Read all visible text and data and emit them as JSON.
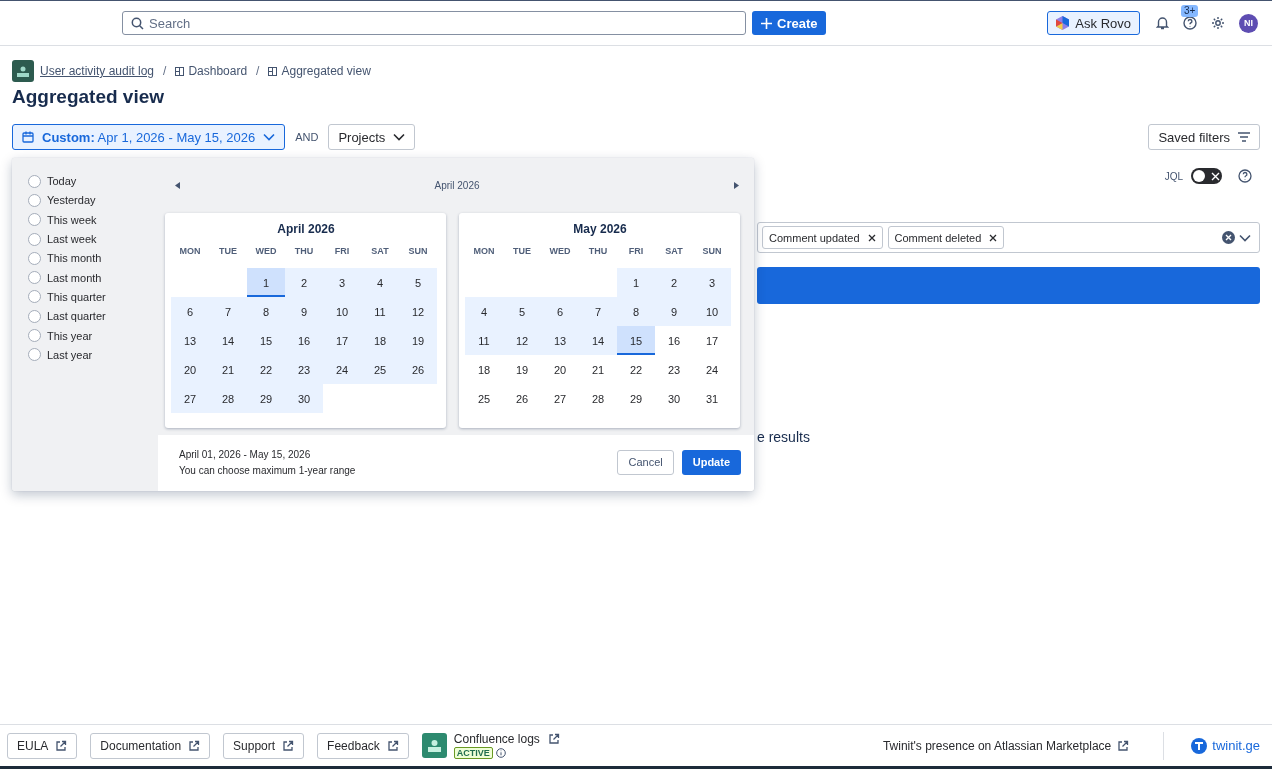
{
  "topbar": {
    "search": {
      "placeholder": "Search"
    },
    "create_button": "Create",
    "ask_button": "Ask Rovo",
    "notifications_badge": "3+",
    "avatar": "NI"
  },
  "breadcrumb_separator": "/",
  "breadcrumbs": [
    {
      "label": "User activity audit log",
      "kind": "link"
    },
    {
      "label": "Dashboard",
      "kind": "page"
    },
    {
      "label": "Aggregated view",
      "kind": "page"
    }
  ],
  "title": "Aggregated view",
  "filters": {
    "date_button": "**Custom:** Apr 1, 2026 - May 15, 2026",
    "operator": "AND",
    "projects": "Projects",
    "saved_filters": "Saved filters"
  },
  "jql": {
    "label": "JQL",
    "on": false
  },
  "event_chips": [
    "Comment updated",
    "Comment deleted"
  ],
  "results_text": "e results",
  "date_picker": {
    "presets": [
      {
        "label": "Today",
        "selected": false
      },
      {
        "label": "Yesterday",
        "selected": false
      },
      {
        "label": "This week",
        "selected": false
      },
      {
        "label": "Last week",
        "selected": false
      },
      {
        "label": "This month",
        "selected": false
      },
      {
        "label": "Last month",
        "selected": false
      },
      {
        "label": "This quarter",
        "selected": false
      },
      {
        "label": "Last quarter",
        "selected": false
      },
      {
        "label": "This year",
        "selected": false
      },
      {
        "label": "Last year",
        "selected": false
      }
    ],
    "nav_title": "April 2026",
    "months": [
      {
        "title": "April 2026",
        "weekdays": [
          "MON",
          "TUE",
          "WED",
          "THU",
          "FRI",
          "SAT",
          "SUN"
        ],
        "weeks": [
          [
            {
              "kind": "blank"
            },
            {
              "kind": "blank"
            },
            {
              "day": "1",
              "in_range": true,
              "selected": true
            },
            {
              "day": "2",
              "in_range": true,
              "selected": false
            },
            {
              "day": "3",
              "in_range": true,
              "selected": false
            },
            {
              "day": "4",
              "in_range": true,
              "selected": false
            },
            {
              "day": "5",
              "in_range": true,
              "selected": false
            }
          ],
          [
            {
              "day": "6",
              "in_range": true,
              "selected": false
            },
            {
              "day": "7",
              "in_range": true,
              "selected": false
            },
            {
              "day": "8",
              "in_range": true,
              "selected": false
            },
            {
              "day": "9",
              "in_range": true,
              "selected": false
            },
            {
              "day": "10",
              "in_range": true,
              "selected": false
            },
            {
              "day": "11",
              "in_range": true,
              "selected": false
            },
            {
              "day": "12",
              "in_range": true,
              "selected": false
            }
          ],
          [
            {
              "day": "13",
              "in_range": true,
              "selected": false
            },
            {
              "day": "14",
              "in_range": true,
              "selected": false
            },
            {
              "day": "15",
              "in_range": true,
              "selected": false
            },
            {
              "day": "16",
              "in_range": true,
              "selected": false
            },
            {
              "day": "17",
              "in_range": true,
              "selected": false
            },
            {
              "day": "18",
              "in_range": true,
              "selected": false
            },
            {
              "day": "19",
              "in_range": true,
              "selected": false
            }
          ],
          [
            {
              "day": "20",
              "in_range": true,
              "selected": false
            },
            {
              "day": "21",
              "in_range": true,
              "selected": false
            },
            {
              "day": "22",
              "in_range": true,
              "selected": false
            },
            {
              "day": "23",
              "in_range": true,
              "selected": false
            },
            {
              "day": "24",
              "in_range": true,
              "selected": false
            },
            {
              "day": "25",
              "in_range": true,
              "selected": false
            },
            {
              "day": "26",
              "in_range": true,
              "selected": false
            }
          ],
          [
            {
              "day": "27",
              "in_range": true,
              "selected": false
            },
            {
              "day": "28",
              "in_range": true,
              "selected": false
            },
            {
              "day": "29",
              "in_range": true,
              "selected": false
            },
            {
              "day": "30",
              "in_range": true,
              "selected": false
            },
            {
              "kind": "blank"
            },
            {
              "kind": "blank"
            },
            {
              "kind": "blank"
            }
          ]
        ]
      },
      {
        "title": "May 2026",
        "weekdays": [
          "MON",
          "TUE",
          "WED",
          "THU",
          "FRI",
          "SAT",
          "SUN"
        ],
        "weeks": [
          [
            {
              "kind": "blank"
            },
            {
              "kind": "blank"
            },
            {
              "kind": "blank"
            },
            {
              "kind": "blank"
            },
            {
              "day": "1",
              "in_range": true,
              "selected": false
            },
            {
              "day": "2",
              "in_range": true,
              "selected": false
            },
            {
              "day": "3",
              "in_range": true,
              "selected": false
            }
          ],
          [
            {
              "day": "4",
              "in_range": true,
              "selected": false
            },
            {
              "day": "5",
              "in_range": true,
              "selected": false
            },
            {
              "day": "6",
              "in_range": true,
              "selected": false
            },
            {
              "day": "7",
              "in_range": true,
              "selected": false
            },
            {
              "day": "8",
              "in_range": true,
              "selected": false
            },
            {
              "day": "9",
              "in_range": true,
              "selected": false
            },
            {
              "day": "10",
              "in_range": true,
              "selected": false
            }
          ],
          [
            {
              "day": "11",
              "in_range": true,
              "selected": false
            },
            {
              "day": "12",
              "in_range": true,
              "selected": false
            },
            {
              "day": "13",
              "in_range": true,
              "selected": false
            },
            {
              "day": "14",
              "in_range": true,
              "selected": false
            },
            {
              "day": "15",
              "in_range": true,
              "selected": true
            },
            {
              "day": "16",
              "in_range": false,
              "selected": false
            },
            {
              "day": "17",
              "in_range": false,
              "selected": false
            }
          ],
          [
            {
              "day": "18",
              "in_range": false,
              "selected": false
            },
            {
              "day": "19",
              "in_range": false,
              "selected": false
            },
            {
              "day": "20",
              "in_range": false,
              "selected": false
            },
            {
              "day": "21",
              "in_range": false,
              "selected": false
            },
            {
              "day": "22",
              "in_range": false,
              "selected": false
            },
            {
              "day": "23",
              "in_range": false,
              "selected": false
            },
            {
              "day": "24",
              "in_range": false,
              "selected": false
            }
          ],
          [
            {
              "day": "25",
              "in_range": false,
              "selected": false
            },
            {
              "day": "26",
              "in_range": false,
              "selected": false
            },
            {
              "day": "27",
              "in_range": false,
              "selected": false
            },
            {
              "day": "28",
              "in_range": false,
              "selected": false
            },
            {
              "day": "29",
              "in_range": false,
              "selected": false
            },
            {
              "day": "30",
              "in_range": false,
              "selected": false
            },
            {
              "day": "31",
              "in_range": false,
              "selected": false
            }
          ]
        ]
      }
    ],
    "summary": "April 01, 2026 - May 15, 2026",
    "hint": "You can choose maximum 1-year range",
    "cancel": "Cancel",
    "update": "Update"
  },
  "footer": {
    "links": [
      "EULA",
      "Documentation",
      "Support",
      "Feedback"
    ],
    "app": {
      "name": "Confluence logs",
      "status": "ACTIVE"
    },
    "marketplace": "Twinit's presence on Atlassian Marketplace",
    "brand": "twinit.ge"
  }
}
